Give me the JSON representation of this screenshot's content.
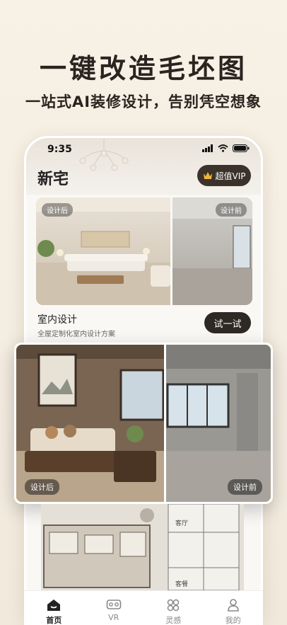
{
  "hero": {
    "title": "一键改造毛坯图",
    "subtitle": "一站式AI装修设计，告别凭空想象"
  },
  "status": {
    "time": "9:35"
  },
  "app": {
    "logo": "新宅",
    "vip_label": "超值VIP"
  },
  "card": {
    "after_tag": "设计后",
    "before_tag": "设计前",
    "title": "室内设计",
    "description": "全屋定制化室内设计方案",
    "try_label": "试一试"
  },
  "compare": {
    "after_label": "设计后",
    "before_label": "设计前"
  },
  "floorplan": {
    "room1": "客厅",
    "room2": "客餐"
  },
  "tabs": [
    {
      "label": "首页",
      "icon": "home-icon",
      "active": true
    },
    {
      "label": "VR",
      "icon": "vr-icon",
      "active": false
    },
    {
      "label": "灵感",
      "icon": "inspiration-icon",
      "active": false
    },
    {
      "label": "我的",
      "icon": "profile-icon",
      "active": false
    }
  ],
  "colors": {
    "accent_dark": "#2e2925",
    "background": "#f5eee2"
  }
}
